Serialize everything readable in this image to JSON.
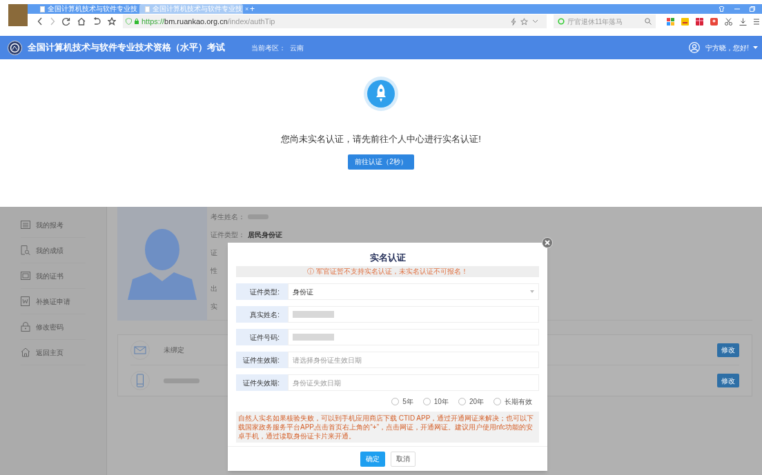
{
  "browser": {
    "tabs": [
      {
        "title": "全国计算机技术与软件专业技",
        "selected": false
      },
      {
        "title": "全国计算机技术与软件专业技",
        "selected": true
      }
    ],
    "url": {
      "scheme": "https://",
      "host": "bm.ruankao.org.cn",
      "path": "/index/authTip"
    },
    "tab_close": "×",
    "new_tab": "+",
    "search": {
      "placeholder": "厅官退休11年落马"
    }
  },
  "site_header": {
    "title": "全国计算机技术与软件专业技术资格（水平）考试",
    "region_label": "当前考区：",
    "region": "云南",
    "greeting": "宁方晓，您好!"
  },
  "auth_tip": {
    "message": "您尚未实名认证，请先前往个人中心进行实名认证!",
    "button": "前往认证（2秒）"
  },
  "sidebar": {
    "items": [
      {
        "label": "我的报考",
        "kind": "list"
      },
      {
        "label": "我的成绩",
        "kind": "search-doc"
      },
      {
        "label": "我的证书",
        "kind": "certificate"
      },
      {
        "label": "补换证申请",
        "kind": "word"
      },
      {
        "label": "修改密码",
        "kind": "lock"
      },
      {
        "label": "返回主页",
        "kind": "home"
      }
    ]
  },
  "profile": {
    "rows": [
      {
        "label": "考生姓名：",
        "redacted": true
      },
      {
        "label": "证件类型：",
        "value": "居民身份证"
      },
      {
        "label": "证"
      },
      {
        "label": "性"
      },
      {
        "label": "出"
      },
      {
        "label": "实"
      }
    ]
  },
  "bindings": [
    {
      "kind": "email",
      "text": "未绑定",
      "button": "修改"
    },
    {
      "kind": "phone",
      "redacted": true,
      "button": "修改"
    }
  ],
  "modal": {
    "title": "实名认证",
    "warning": "ⓘ 军官证暂不支持实名认证，未实名认证不可报名！",
    "fields": [
      {
        "label": "证件类型:",
        "kind": "select",
        "value": "身份证"
      },
      {
        "label": "真实姓名:",
        "kind": "text",
        "redacted": true
      },
      {
        "label": "证件号码:",
        "kind": "text",
        "redacted": true
      },
      {
        "label": "证件生效期:",
        "kind": "text",
        "placeholder": "请选择身份证生效日期"
      },
      {
        "label": "证件失效期:",
        "kind": "text",
        "placeholder": "身份证失效日期"
      }
    ],
    "radios": [
      {
        "label": "5年",
        "selected": false
      },
      {
        "label": "10年",
        "selected": false
      },
      {
        "label": "20年",
        "selected": false
      },
      {
        "label": "长期有效",
        "selected": false
      }
    ],
    "notice": "自然人实名如果核验失败，可以到手机应用商店下载 CTID APP，通过开通网证来解决；也可以下载国家政务服务平台APP,点击首页右上角的“+”，点击网证，开通网证。建议用户使用nfc功能的安卓手机，通过读取身份证卡片来开通。",
    "buttons": [
      {
        "label": "确定",
        "primary": true
      },
      {
        "label": "取消",
        "primary": false
      }
    ]
  }
}
